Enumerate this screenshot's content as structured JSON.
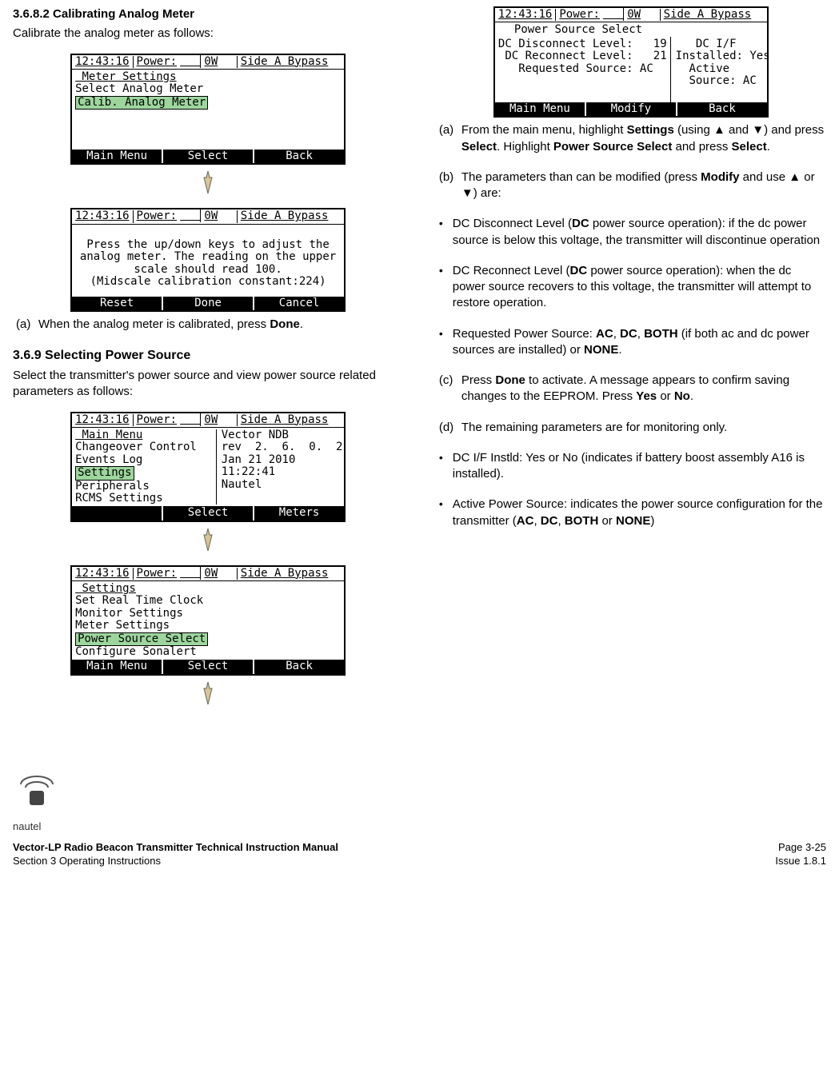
{
  "section1_heading": "3.6.8.2 Calibrating Analog Meter",
  "section1_intro": "Calibrate the analog meter as follows:",
  "lcd_common_status": {
    "time": " 12:43:16",
    "power_lbl": "Power:",
    "power_val": "0W",
    "mode": "Side A Bypass"
  },
  "lcd1_menu_title": " Meter Settings",
  "lcd1_item1": "Select Analog Meter",
  "lcd1_item2": "Calib. Analog Meter",
  "lcd1_soft1": "Main Menu",
  "lcd1_soft2": "Select",
  "lcd1_soft3": "Back",
  "lcd2_l1": "Press the up/down keys to adjust the",
  "lcd2_l2": "analog meter. The reading on the upper",
  "lcd2_l3": "scale should read 100.",
  "lcd2_l4": "(Midscale calibration constant:224)",
  "lcd2_soft1": "Reset",
  "lcd2_soft2": "Done",
  "lcd2_soft3": "Cancel",
  "section1_a_letter": "(a)",
  "section1_a": "When the analog meter is calibrated, press Done.",
  "section2_heading": "3.6.9 Selecting Power Source",
  "section2_intro": "Select the transmitter's power source and view power source related parameters as follows:",
  "lcd3_menu_title": " Main Menu",
  "lcd3_items": [
    "Changeover Control",
    "Events Log",
    "Settings",
    "Peripherals",
    "RCMS Settings"
  ],
  "lcd3_right": [
    "Vector NDB",
    "rev  2.  6.  0.  2",
    "Jan 21 2010",
    "11:22:41",
    "Nautel"
  ],
  "lcd3_soft1": "",
  "lcd3_soft2": "Select",
  "lcd3_soft3": "Meters",
  "lcd4_menu_title": " Settings",
  "lcd4_items": [
    "Set Real Time Clock",
    "Monitor Settings",
    "Meter Settings",
    "Power Source Select",
    "Configure Sonalert"
  ],
  "lcd4_soft1": "Main Menu",
  "lcd4_soft2": "Select",
  "lcd4_soft3": "Back",
  "lcd5_title": "Power Source Select",
  "lcd5_l1": "DC Disconnect Level:   19",
  "lcd5_l2": " DC Reconnect Level:   21",
  "lcd5_l3": "   Requested Source: AC",
  "lcd5_r1": "   DC I/F",
  "lcd5_r2": "Installed: Yes",
  "lcd5_r3": "  Active",
  "lcd5_r4": "  Source: AC",
  "lcd5_soft1": "Main Menu",
  "lcd5_soft2": "Modify",
  "lcd5_soft3": "Back",
  "right_a_letter": "(a)",
  "right_a_pre": "From the main menu, highlight ",
  "right_a_b1": "Settings",
  "right_a_mid1": " (using ",
  "right_a_mid2": " and ",
  "right_a_mid3": ") and press ",
  "right_a_b2": "Select",
  "right_a_mid4": ". Highlight ",
  "right_a_b3": "Power Source Select",
  "right_a_mid5": " and press ",
  "right_a_b4": "Select",
  "right_a_end": ".",
  "right_b_letter": "(b)",
  "right_b_pre": "The parameters than can be modified (press ",
  "right_b_b1": "Modify",
  "right_b_mid1": " and use ",
  "right_b_mid2": " or ",
  "right_b_end": ") are:",
  "bullet1_pre": "DC Disconnect Level (",
  "bullet1_b1": "DC",
  "bullet1_post": " power source operation): if the dc power source is below this voltage, the transmitter will discontinue operation",
  "bullet2_pre": "DC Reconnect Level (",
  "bullet2_b1": "DC",
  "bullet2_post": " power source operation): when the dc power source recovers to this voltage, the transmitter will attempt to restore operation.",
  "bullet3_pre": "Requested Power Source: ",
  "bullet3_b1": "AC",
  "bullet3_sep1": ", ",
  "bullet3_b2": "DC",
  "bullet3_sep2": ", ",
  "bullet3_b3": "BOTH",
  "bullet3_mid": " (if both ac and dc power sources are installed) or ",
  "bullet3_b4": "NONE",
  "bullet3_end": ".",
  "right_c_letter": "(c)",
  "right_c_pre": "Press ",
  "right_c_b1": "Done",
  "right_c_mid": " to activate. A message appears to confirm saving changes to the EEPROM. Press ",
  "right_c_b2": "Yes",
  "right_c_sep": " or ",
  "right_c_b3": "No",
  "right_c_end": ".",
  "right_d_letter": "(d)",
  "right_d": "The remaining parameters are for monitoring only.",
  "bullet4": "DC I/F Instld: Yes or No (indicates if battery boost assembly A16 is installed).",
  "bullet5_pre": "Active Power Source: indicates the power source configuration for the transmitter (",
  "bullet5_b1": "AC",
  "bullet5_s1": ", ",
  "bullet5_b2": "DC",
  "bullet5_s2": ", ",
  "bullet5_b3": "BOTH",
  "bullet5_s3": " or ",
  "bullet5_b4": "NONE",
  "bullet5_end": ")",
  "footer_title": "Vector-LP Radio Beacon Transmitter Technical Instruction Manual",
  "footer_section": "Section 3 Operating Instructions",
  "footer_page": "Page 3-25",
  "footer_issue": "Issue 1.8.1",
  "logo_text": "nautel"
}
